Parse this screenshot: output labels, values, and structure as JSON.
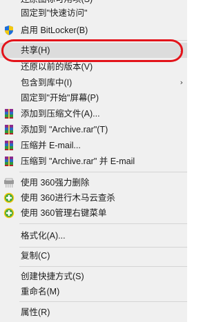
{
  "menu": {
    "items": [
      {
        "label": "还原图标可用项(S)",
        "icon": "",
        "arrow": false
      },
      {
        "label": "固定到\"快速访问\"",
        "icon": "",
        "arrow": false
      },
      {
        "label": "启用 BitLocker(B)",
        "icon": "shield-icon",
        "arrow": false
      },
      {
        "label": "共享(H)",
        "icon": "",
        "arrow": true
      },
      {
        "label": "还原以前的版本(V)",
        "icon": "",
        "arrow": false
      },
      {
        "label": "包含到库中(I)",
        "icon": "",
        "arrow": true
      },
      {
        "label": "固定到\"开始\"屏幕(P)",
        "icon": "",
        "arrow": false
      },
      {
        "label": "添加到压缩文件(A)...",
        "icon": "winrar-icon",
        "arrow": false
      },
      {
        "label": "添加到 \"Archive.rar\"(T)",
        "icon": "winrar-icon",
        "arrow": false
      },
      {
        "label": "压缩并 E-mail...",
        "icon": "winrar-icon",
        "arrow": false
      },
      {
        "label": "压缩到 \"Archive.rar\" 并 E-mail",
        "icon": "winrar-icon",
        "arrow": false
      },
      {
        "label": "使用 360强力删除",
        "icon": "shredder-icon",
        "arrow": false
      },
      {
        "label": "使用 360进行木马云查杀",
        "icon": "360-plus-icon",
        "arrow": false
      },
      {
        "label": "使用 360管理右键菜单",
        "icon": "360-plus-icon",
        "arrow": false
      },
      {
        "label": "格式化(A)...",
        "icon": "",
        "arrow": false
      },
      {
        "label": "复制(C)",
        "icon": "",
        "arrow": false
      },
      {
        "label": "创建快捷方式(S)",
        "icon": "",
        "arrow": false
      },
      {
        "label": "重命名(M)",
        "icon": "",
        "arrow": false
      },
      {
        "label": "属性(R)",
        "icon": "",
        "arrow": false
      }
    ],
    "arrow_glyph": "›",
    "highlight_color": "#e3131a"
  }
}
